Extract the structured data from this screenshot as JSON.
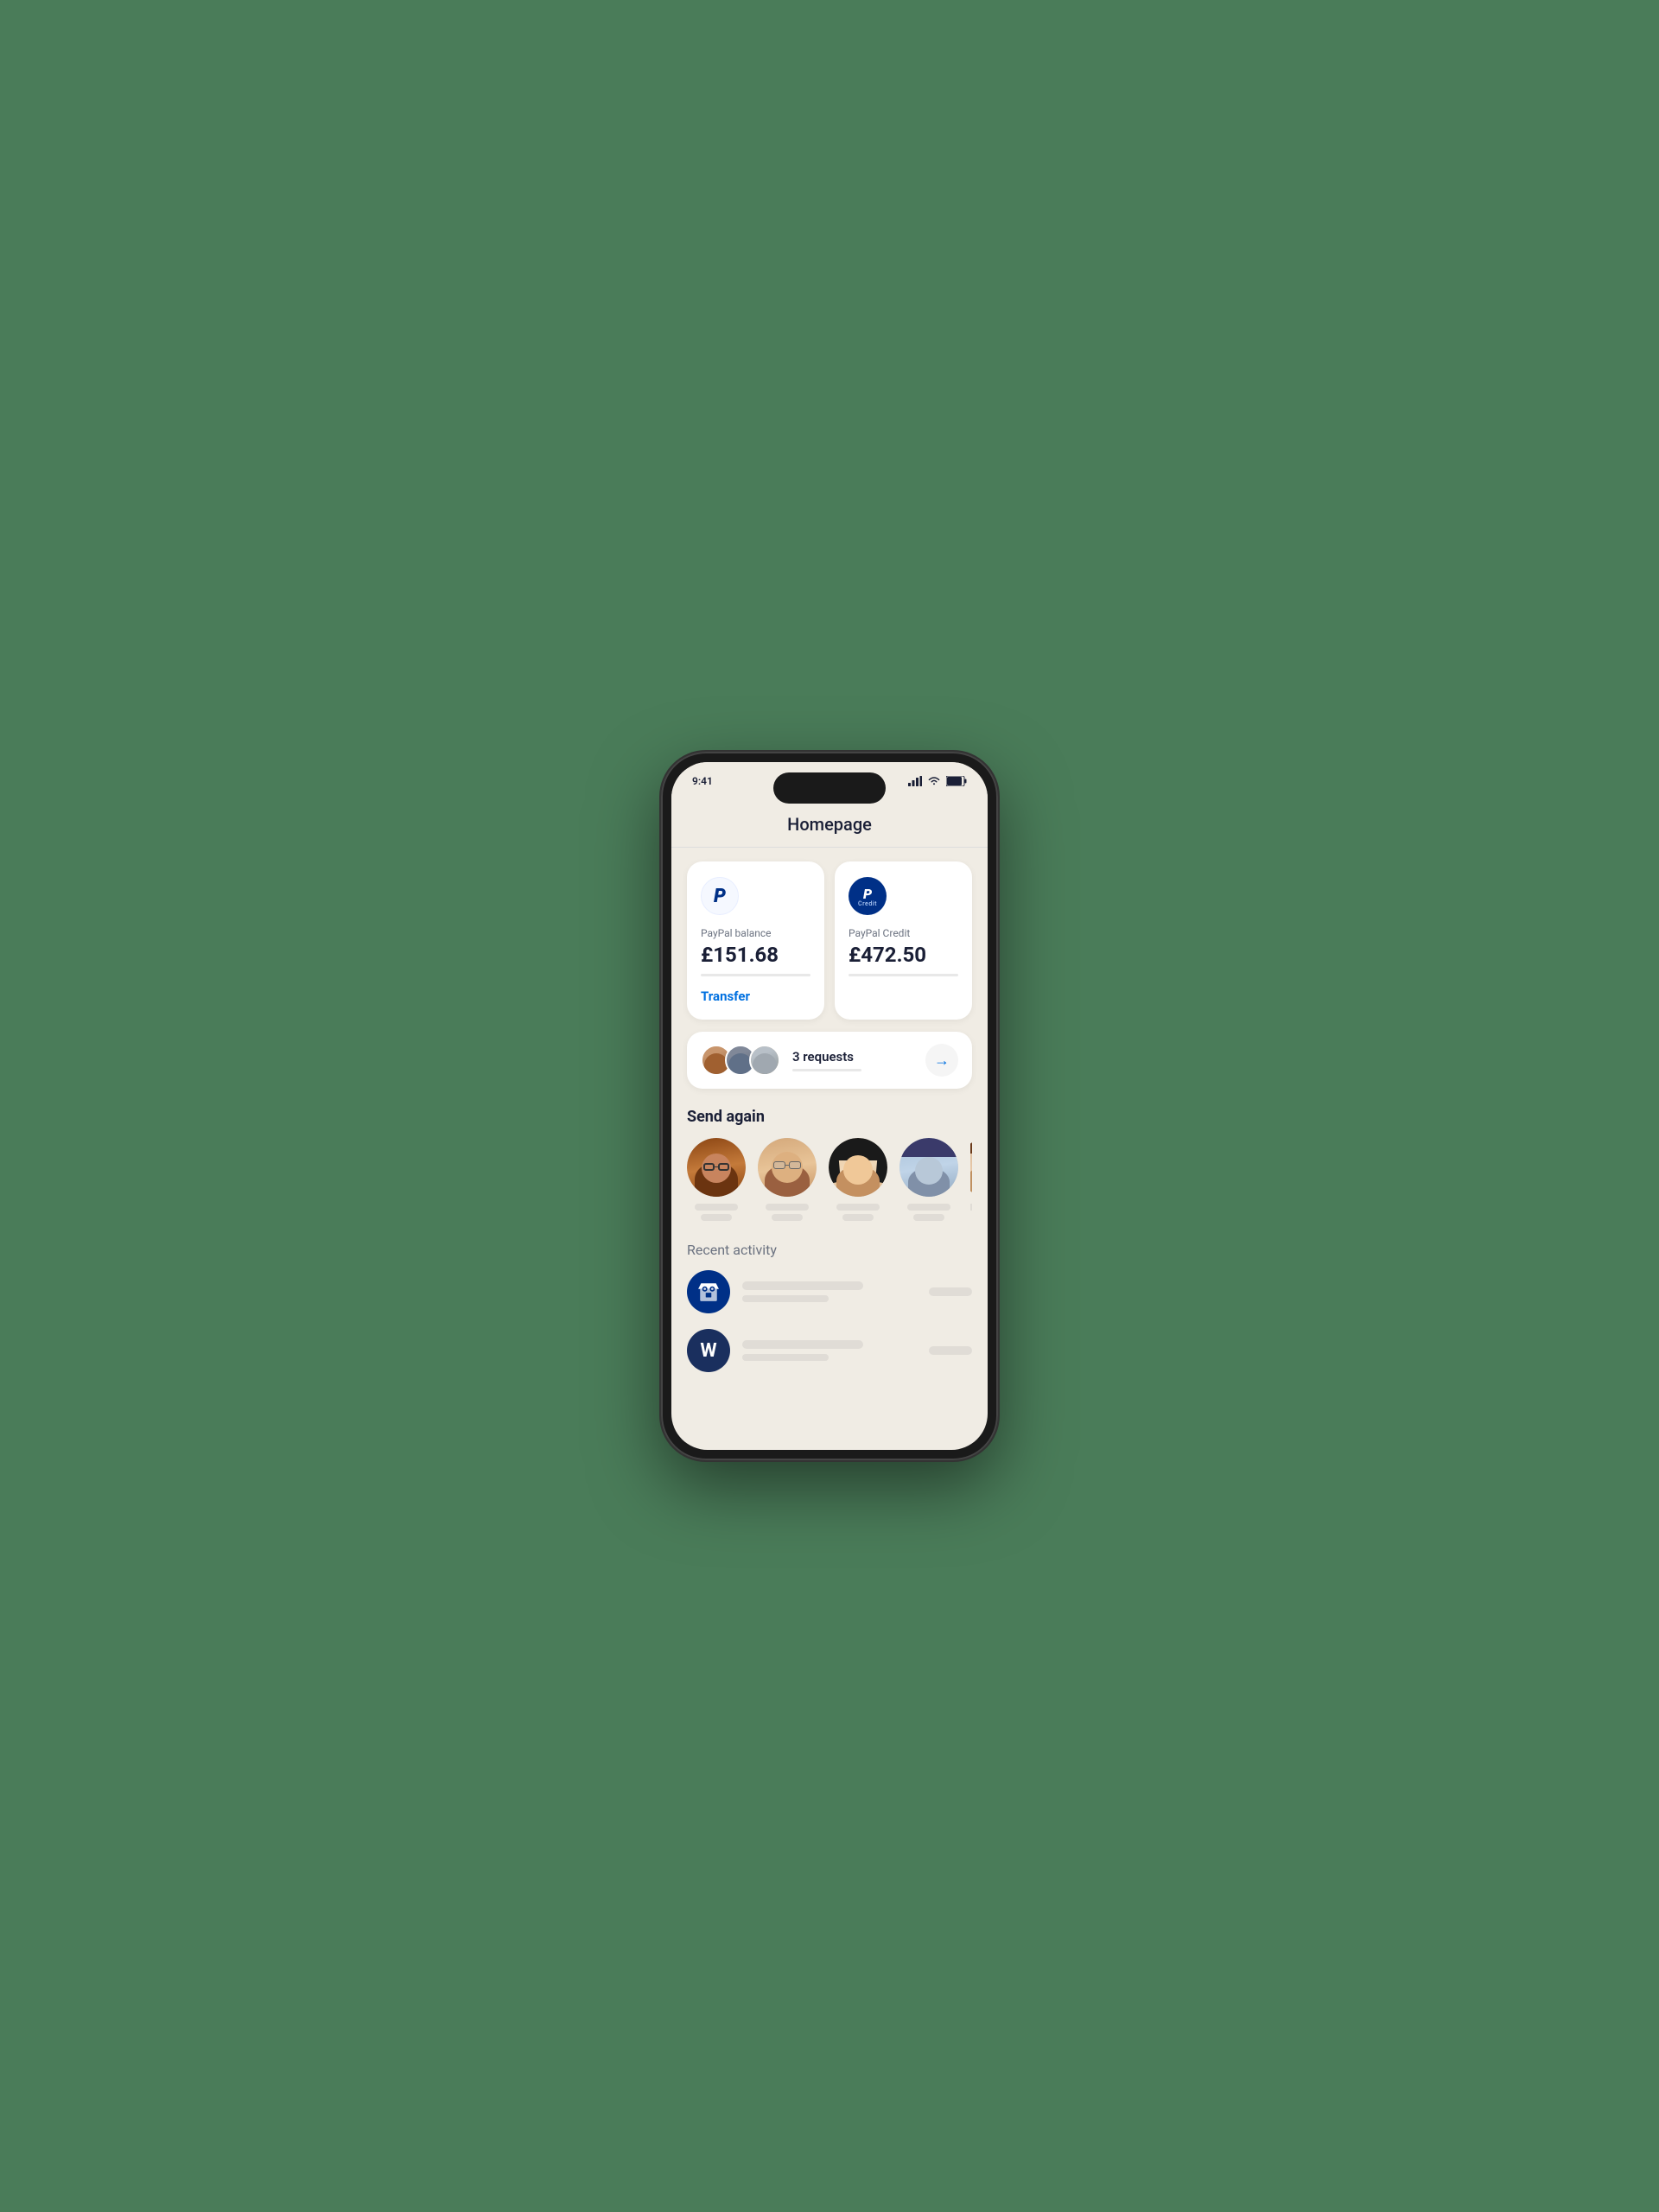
{
  "page": {
    "title": "Homepage",
    "background_color": "#4a7c59"
  },
  "cards": {
    "paypal_balance": {
      "label": "PayPal balance",
      "amount": "£151.68",
      "transfer_label": "Transfer"
    },
    "paypal_credit": {
      "label": "PayPal Credit",
      "amount": "£472.50",
      "credit_text": "Credit"
    }
  },
  "requests": {
    "count_text": "3 requests",
    "arrow": "→"
  },
  "send_again": {
    "title": "Send again",
    "people": [
      {
        "id": 1,
        "face_class": "face-1"
      },
      {
        "id": 2,
        "face_class": "face-2"
      },
      {
        "id": 3,
        "face_class": "face-3"
      },
      {
        "id": 4,
        "face_class": "face-4"
      },
      {
        "id": 5,
        "face_class": "face-5"
      }
    ]
  },
  "recent_activity": {
    "title": "Recent activity",
    "items": [
      {
        "type": "shop",
        "icon_type": "shop"
      },
      {
        "type": "initial",
        "initial": "W"
      }
    ]
  }
}
